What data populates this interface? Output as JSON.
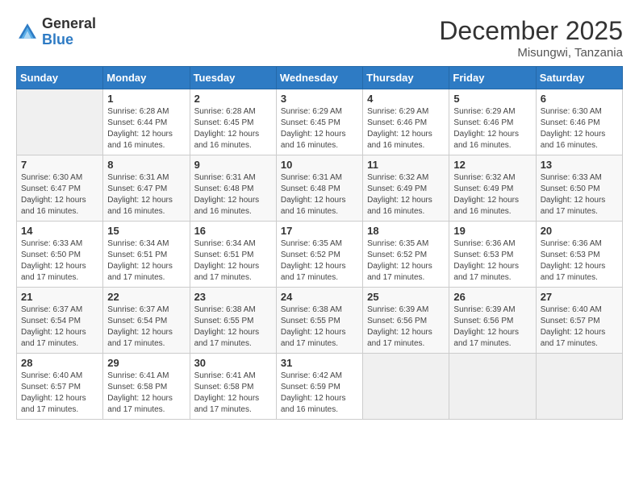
{
  "header": {
    "logo_general": "General",
    "logo_blue": "Blue",
    "month_year": "December 2025",
    "location": "Misungwi, Tanzania"
  },
  "days_of_week": [
    "Sunday",
    "Monday",
    "Tuesday",
    "Wednesday",
    "Thursday",
    "Friday",
    "Saturday"
  ],
  "weeks": [
    [
      {
        "day": "",
        "sunrise": "",
        "sunset": "",
        "daylight": ""
      },
      {
        "day": "1",
        "sunrise": "Sunrise: 6:28 AM",
        "sunset": "Sunset: 6:44 PM",
        "daylight": "Daylight: 12 hours and 16 minutes."
      },
      {
        "day": "2",
        "sunrise": "Sunrise: 6:28 AM",
        "sunset": "Sunset: 6:45 PM",
        "daylight": "Daylight: 12 hours and 16 minutes."
      },
      {
        "day": "3",
        "sunrise": "Sunrise: 6:29 AM",
        "sunset": "Sunset: 6:45 PM",
        "daylight": "Daylight: 12 hours and 16 minutes."
      },
      {
        "day": "4",
        "sunrise": "Sunrise: 6:29 AM",
        "sunset": "Sunset: 6:46 PM",
        "daylight": "Daylight: 12 hours and 16 minutes."
      },
      {
        "day": "5",
        "sunrise": "Sunrise: 6:29 AM",
        "sunset": "Sunset: 6:46 PM",
        "daylight": "Daylight: 12 hours and 16 minutes."
      },
      {
        "day": "6",
        "sunrise": "Sunrise: 6:30 AM",
        "sunset": "Sunset: 6:46 PM",
        "daylight": "Daylight: 12 hours and 16 minutes."
      }
    ],
    [
      {
        "day": "7",
        "sunrise": "Sunrise: 6:30 AM",
        "sunset": "Sunset: 6:47 PM",
        "daylight": "Daylight: 12 hours and 16 minutes."
      },
      {
        "day": "8",
        "sunrise": "Sunrise: 6:31 AM",
        "sunset": "Sunset: 6:47 PM",
        "daylight": "Daylight: 12 hours and 16 minutes."
      },
      {
        "day": "9",
        "sunrise": "Sunrise: 6:31 AM",
        "sunset": "Sunset: 6:48 PM",
        "daylight": "Daylight: 12 hours and 16 minutes."
      },
      {
        "day": "10",
        "sunrise": "Sunrise: 6:31 AM",
        "sunset": "Sunset: 6:48 PM",
        "daylight": "Daylight: 12 hours and 16 minutes."
      },
      {
        "day": "11",
        "sunrise": "Sunrise: 6:32 AM",
        "sunset": "Sunset: 6:49 PM",
        "daylight": "Daylight: 12 hours and 16 minutes."
      },
      {
        "day": "12",
        "sunrise": "Sunrise: 6:32 AM",
        "sunset": "Sunset: 6:49 PM",
        "daylight": "Daylight: 12 hours and 16 minutes."
      },
      {
        "day": "13",
        "sunrise": "Sunrise: 6:33 AM",
        "sunset": "Sunset: 6:50 PM",
        "daylight": "Daylight: 12 hours and 17 minutes."
      }
    ],
    [
      {
        "day": "14",
        "sunrise": "Sunrise: 6:33 AM",
        "sunset": "Sunset: 6:50 PM",
        "daylight": "Daylight: 12 hours and 17 minutes."
      },
      {
        "day": "15",
        "sunrise": "Sunrise: 6:34 AM",
        "sunset": "Sunset: 6:51 PM",
        "daylight": "Daylight: 12 hours and 17 minutes."
      },
      {
        "day": "16",
        "sunrise": "Sunrise: 6:34 AM",
        "sunset": "Sunset: 6:51 PM",
        "daylight": "Daylight: 12 hours and 17 minutes."
      },
      {
        "day": "17",
        "sunrise": "Sunrise: 6:35 AM",
        "sunset": "Sunset: 6:52 PM",
        "daylight": "Daylight: 12 hours and 17 minutes."
      },
      {
        "day": "18",
        "sunrise": "Sunrise: 6:35 AM",
        "sunset": "Sunset: 6:52 PM",
        "daylight": "Daylight: 12 hours and 17 minutes."
      },
      {
        "day": "19",
        "sunrise": "Sunrise: 6:36 AM",
        "sunset": "Sunset: 6:53 PM",
        "daylight": "Daylight: 12 hours and 17 minutes."
      },
      {
        "day": "20",
        "sunrise": "Sunrise: 6:36 AM",
        "sunset": "Sunset: 6:53 PM",
        "daylight": "Daylight: 12 hours and 17 minutes."
      }
    ],
    [
      {
        "day": "21",
        "sunrise": "Sunrise: 6:37 AM",
        "sunset": "Sunset: 6:54 PM",
        "daylight": "Daylight: 12 hours and 17 minutes."
      },
      {
        "day": "22",
        "sunrise": "Sunrise: 6:37 AM",
        "sunset": "Sunset: 6:54 PM",
        "daylight": "Daylight: 12 hours and 17 minutes."
      },
      {
        "day": "23",
        "sunrise": "Sunrise: 6:38 AM",
        "sunset": "Sunset: 6:55 PM",
        "daylight": "Daylight: 12 hours and 17 minutes."
      },
      {
        "day": "24",
        "sunrise": "Sunrise: 6:38 AM",
        "sunset": "Sunset: 6:55 PM",
        "daylight": "Daylight: 12 hours and 17 minutes."
      },
      {
        "day": "25",
        "sunrise": "Sunrise: 6:39 AM",
        "sunset": "Sunset: 6:56 PM",
        "daylight": "Daylight: 12 hours and 17 minutes."
      },
      {
        "day": "26",
        "sunrise": "Sunrise: 6:39 AM",
        "sunset": "Sunset: 6:56 PM",
        "daylight": "Daylight: 12 hours and 17 minutes."
      },
      {
        "day": "27",
        "sunrise": "Sunrise: 6:40 AM",
        "sunset": "Sunset: 6:57 PM",
        "daylight": "Daylight: 12 hours and 17 minutes."
      }
    ],
    [
      {
        "day": "28",
        "sunrise": "Sunrise: 6:40 AM",
        "sunset": "Sunset: 6:57 PM",
        "daylight": "Daylight: 12 hours and 17 minutes."
      },
      {
        "day": "29",
        "sunrise": "Sunrise: 6:41 AM",
        "sunset": "Sunset: 6:58 PM",
        "daylight": "Daylight: 12 hours and 17 minutes."
      },
      {
        "day": "30",
        "sunrise": "Sunrise: 6:41 AM",
        "sunset": "Sunset: 6:58 PM",
        "daylight": "Daylight: 12 hours and 17 minutes."
      },
      {
        "day": "31",
        "sunrise": "Sunrise: 6:42 AM",
        "sunset": "Sunset: 6:59 PM",
        "daylight": "Daylight: 12 hours and 16 minutes."
      },
      {
        "day": "",
        "sunrise": "",
        "sunset": "",
        "daylight": ""
      },
      {
        "day": "",
        "sunrise": "",
        "sunset": "",
        "daylight": ""
      },
      {
        "day": "",
        "sunrise": "",
        "sunset": "",
        "daylight": ""
      }
    ]
  ]
}
